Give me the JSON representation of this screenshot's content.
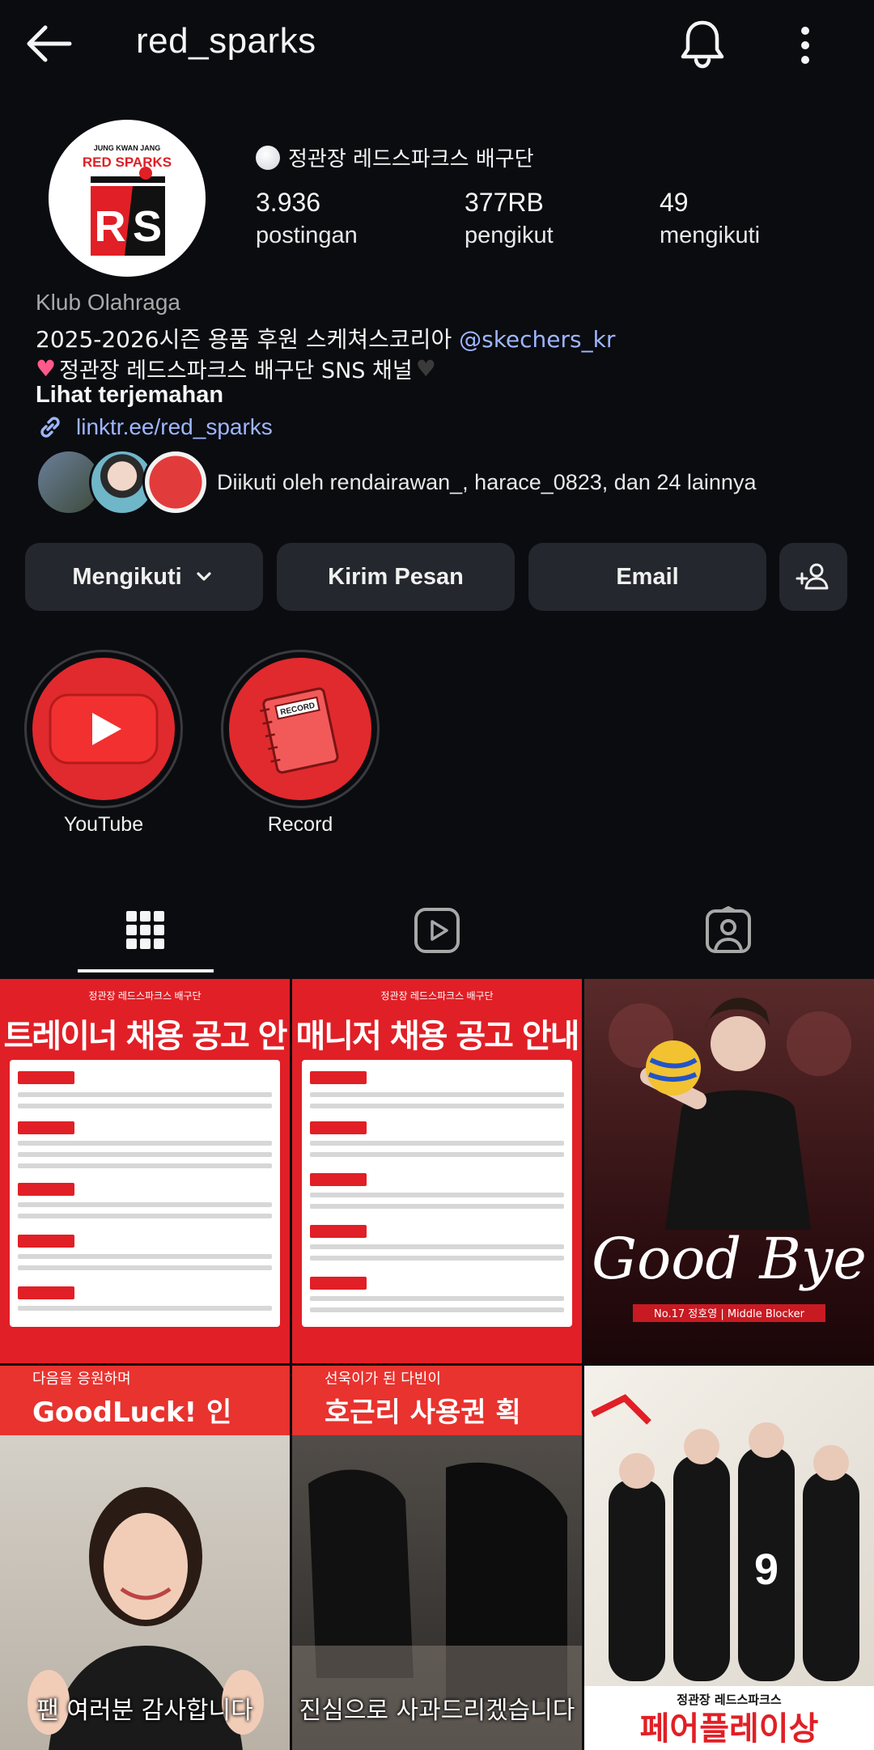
{
  "header": {
    "username": "red_sparks"
  },
  "profile": {
    "display_name": "정관장 레드스파크스 배구단",
    "avatar_text_top": "JUNG KWAN JANG",
    "avatar_text_brand": "RED SPARKS",
    "stats": [
      {
        "value": "3.936",
        "label": "postingan"
      },
      {
        "value": "377RB",
        "label": "pengikut"
      },
      {
        "value": "49",
        "label": "mengikuti"
      }
    ],
    "category": "Klub Olahraga",
    "bio_line1": "2025-2026시즌 용품 후원 스케쳐스코리아 ",
    "bio_mention": "@skechers_kr",
    "bio_line2": "정관장 레드스파크스 배구단 SNS 채널",
    "see_translation": "Lihat terjemahan",
    "link": "linktr.ee/red_sparks",
    "followed_by": "Diikuti oleh rendairawan_, harace_0823, dan 24 lainnya"
  },
  "buttons": {
    "following": "Mengikuti",
    "message": "Kirim Pesan",
    "email": "Email"
  },
  "highlights": [
    {
      "label": "YouTube"
    },
    {
      "label": "Record"
    }
  ],
  "posts": [
    {
      "title": "트레이너 채용 공고 안내",
      "subtitle": "정관장 레드스파크스 배구단"
    },
    {
      "title": "매니저 채용 공고 안내",
      "subtitle": "정관장 레드스파크스 배구단"
    },
    {
      "title": "Good Bye",
      "caption": "No.17 정호영 | Middle Blocker"
    },
    {
      "title": "GoodLuck! 인",
      "caption": "팬 여러분 감사합니다",
      "banner_top": "다음을 응원하며"
    },
    {
      "title": "호근리 사용권 획",
      "caption": "진심으로 사과드리겠습니다",
      "banner_top": "선욱이가 된 다빈이"
    },
    {
      "title": "페어플레이상",
      "subtitle": "정관장 레드스파크스"
    }
  ],
  "colors": {
    "brand_red": "#e11f26",
    "link_blue": "#9db6ff",
    "button_bg": "#24272d"
  }
}
